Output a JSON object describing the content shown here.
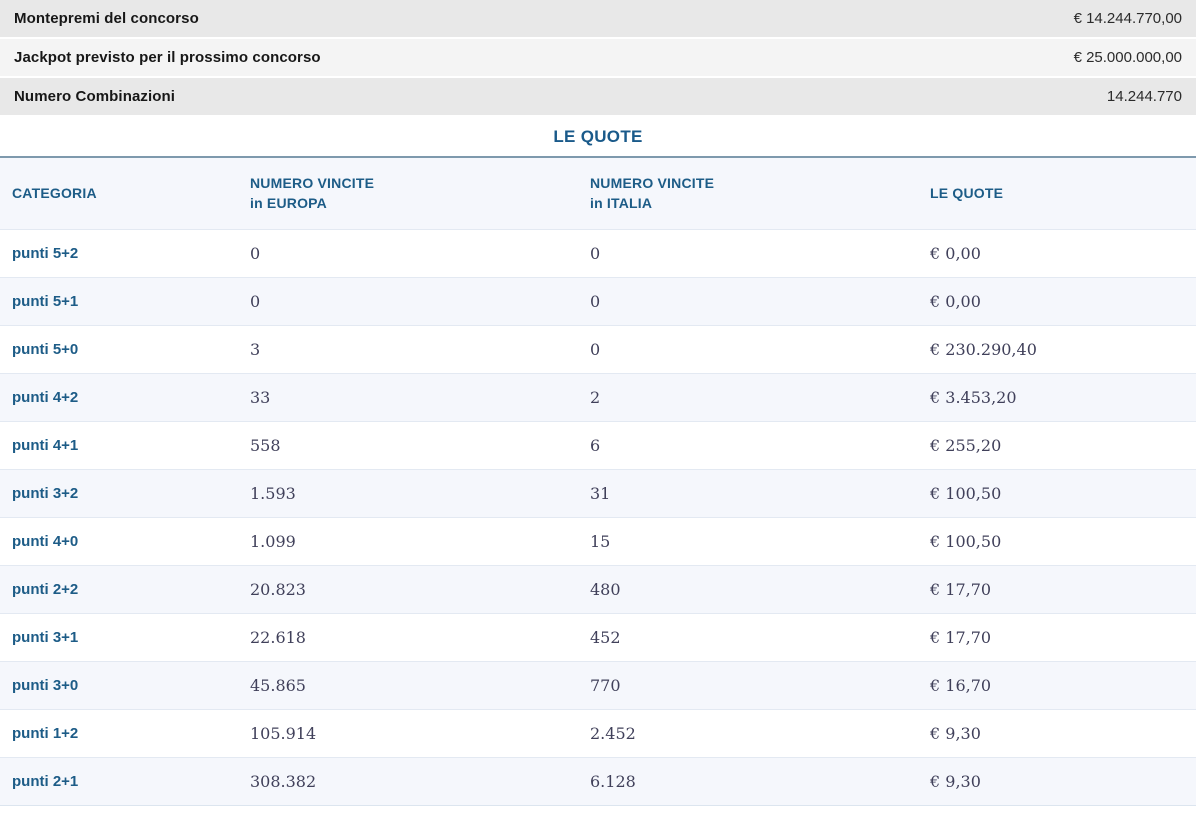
{
  "summary": {
    "rows": [
      {
        "label": "Montepremi del concorso",
        "value": "€ 14.244.770,00"
      },
      {
        "label": "Jackpot previsto per il prossimo concorso",
        "value": "€ 25.000.000,00"
      },
      {
        "label": "Numero Combinazioni",
        "value": "14.244.770"
      }
    ]
  },
  "section": {
    "title": "LE QUOTE"
  },
  "table": {
    "headers": {
      "categoria": "CATEGORIA",
      "europa_line1": "NUMERO VINCITE",
      "europa_line2": "in EUROPA",
      "italia_line1": "NUMERO VINCITE",
      "italia_line2": "in ITALIA",
      "quote": "LE QUOTE"
    },
    "rows": [
      {
        "categoria": "punti 5+2",
        "europa": "0",
        "italia": "0",
        "quota": "€ 0,00"
      },
      {
        "categoria": "punti 5+1",
        "europa": "0",
        "italia": "0",
        "quota": "€ 0,00"
      },
      {
        "categoria": "punti 5+0",
        "europa": "3",
        "italia": "0",
        "quota": "€ 230.290,40"
      },
      {
        "categoria": "punti 4+2",
        "europa": "33",
        "italia": "2",
        "quota": "€ 3.453,20"
      },
      {
        "categoria": "punti 4+1",
        "europa": "558",
        "italia": "6",
        "quota": "€ 255,20"
      },
      {
        "categoria": "punti 3+2",
        "europa": "1.593",
        "italia": "31",
        "quota": "€ 100,50"
      },
      {
        "categoria": "punti 4+0",
        "europa": "1.099",
        "italia": "15",
        "quota": "€ 100,50"
      },
      {
        "categoria": "punti 2+2",
        "europa": "20.823",
        "italia": "480",
        "quota": "€ 17,70"
      },
      {
        "categoria": "punti 3+1",
        "europa": "22.618",
        "italia": "452",
        "quota": "€ 17,70"
      },
      {
        "categoria": "punti 3+0",
        "europa": "45.865",
        "italia": "770",
        "quota": "€ 16,70"
      },
      {
        "categoria": "punti 1+2",
        "europa": "105.914",
        "italia": "2.452",
        "quota": "€ 9,30"
      },
      {
        "categoria": "punti 2+1",
        "europa": "308.382",
        "italia": "6.128",
        "quota": "€ 9,30"
      }
    ]
  },
  "colors": {
    "accent_blue": "#1d5c87",
    "title_blue": "#1a5a8a",
    "divider_steel": "#7e99ad",
    "header_row_bg": "#f5f7fc",
    "row_alt_bg": "#f5f7fc",
    "summary_bg_dark": "#e8e8e8",
    "summary_bg_light": "#f4f4f4",
    "number_text": "#40405a"
  }
}
